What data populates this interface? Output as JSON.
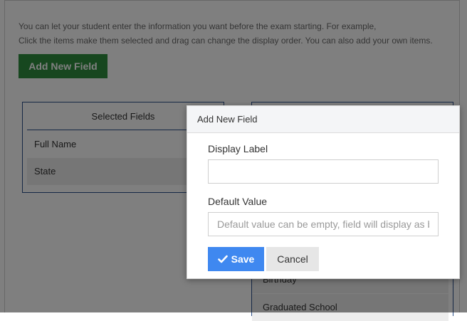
{
  "description": {
    "line1": "You can let your student enter the information you want before the exam starting. For example,",
    "line2": "Click the items make them selected and drag can change the display order. You can also add your own items."
  },
  "add_button_label": "Add New Field",
  "selected_panel": {
    "title": "Selected Fields",
    "items": [
      "Full Name",
      "State"
    ]
  },
  "available_panel": {
    "items": [
      "Birthday",
      "Graduated School"
    ]
  },
  "modal": {
    "title": "Add New Field",
    "display_label": "Display Label",
    "display_value": "",
    "default_label": "Default Value",
    "default_placeholder": "Default value can be empty, field will display as blank",
    "save_label": "Save",
    "cancel_label": "Cancel"
  },
  "colors": {
    "primary": "#3f88f0",
    "success": "#2f8f3f",
    "border_accent": "#2b4f8a"
  }
}
